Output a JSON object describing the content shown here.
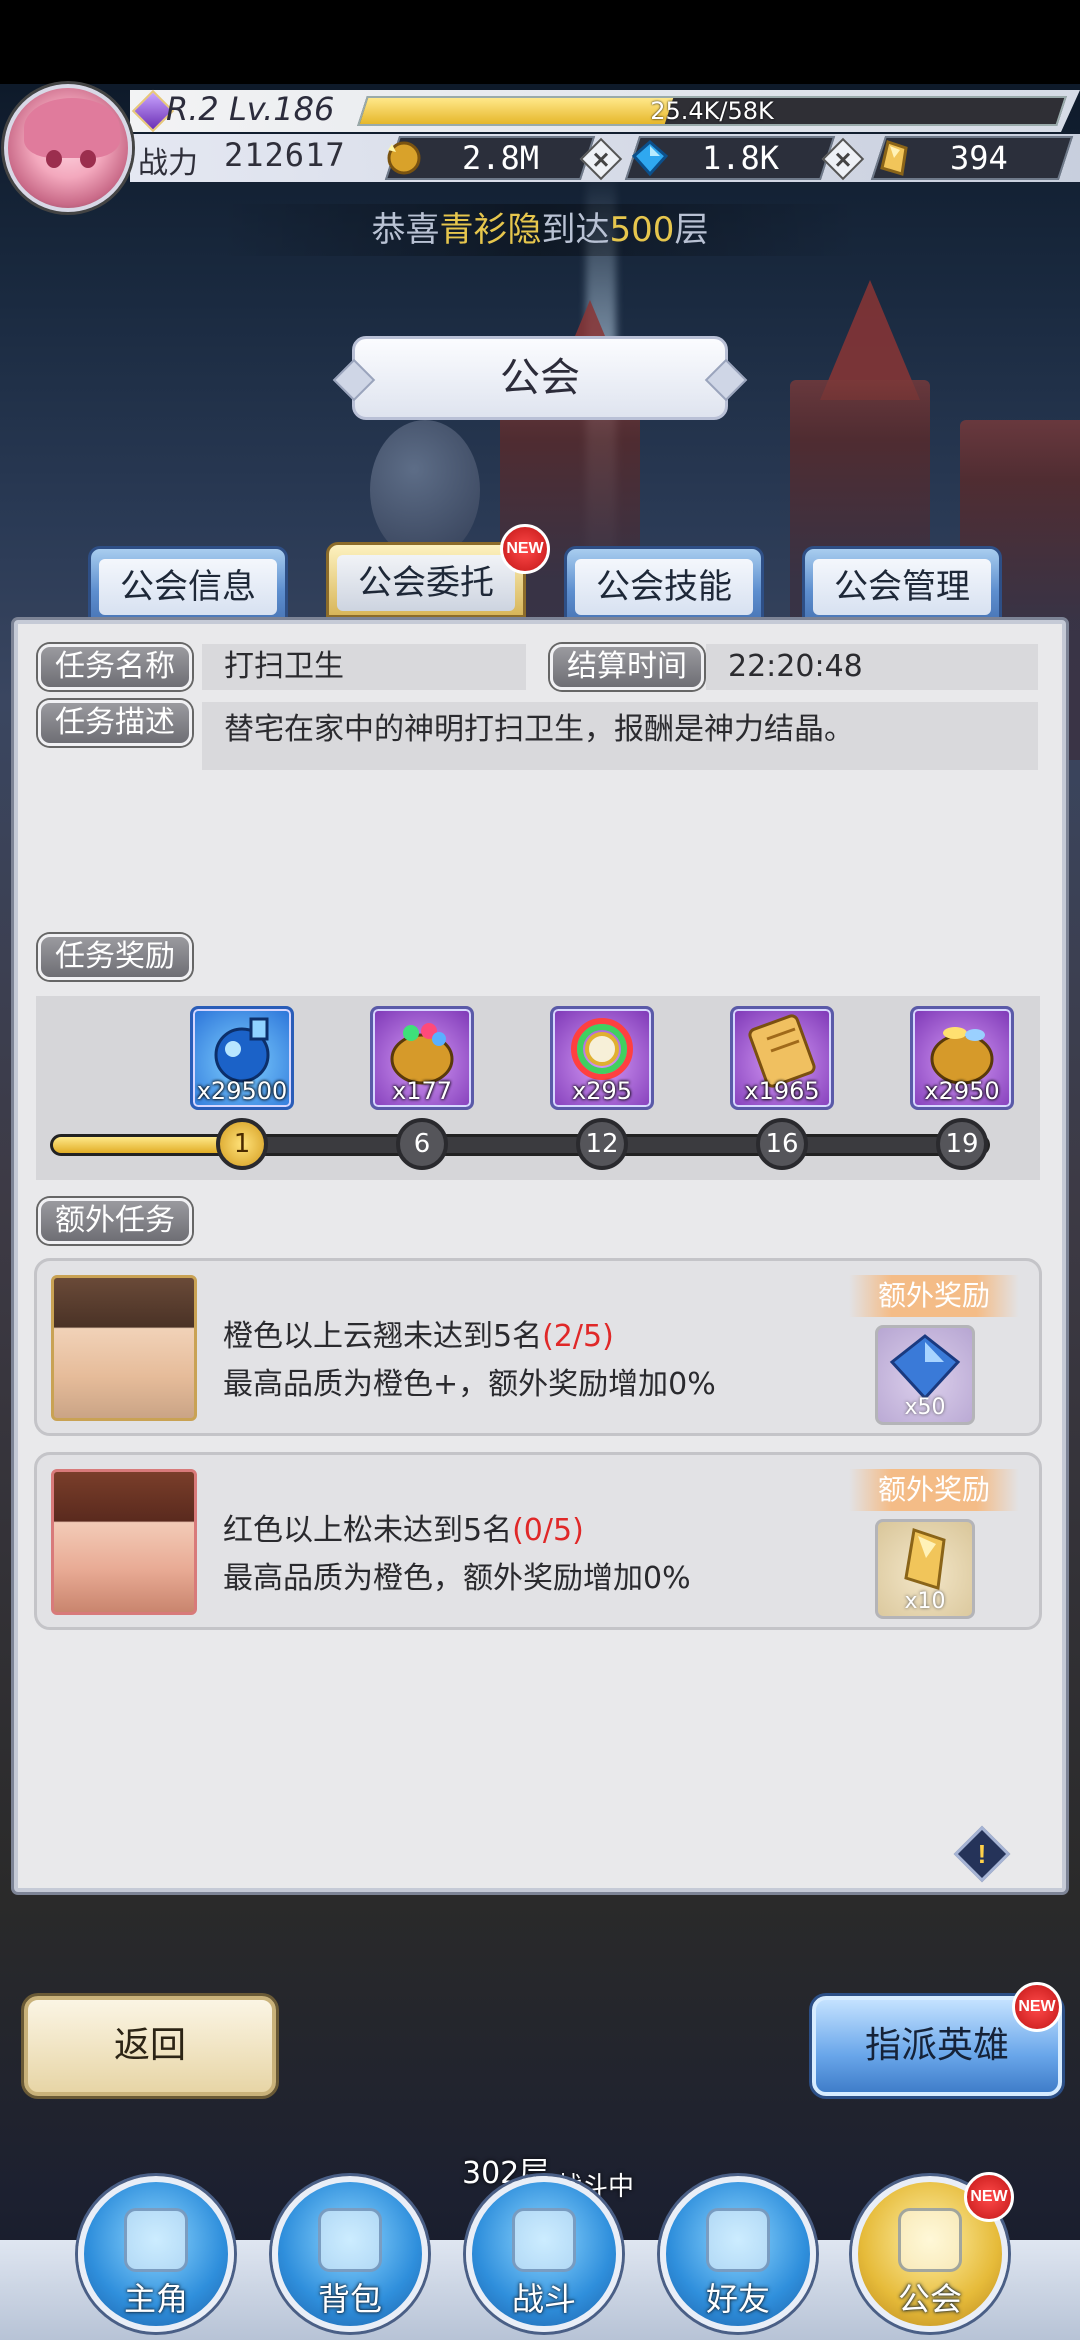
{
  "player": {
    "rank_level": "R.2 Lv.186",
    "exp_text": "25.4K/58K",
    "exp_progress": 0.438,
    "power_label": "战力",
    "power_value": "212617"
  },
  "resources": [
    {
      "name": "gold",
      "icon": "gold-coin-icon",
      "value": "2.8M"
    },
    {
      "name": "diamond",
      "icon": "blue-diamond-icon",
      "value": "1.8K"
    },
    {
      "name": "crystal",
      "icon": "gold-crystal-icon",
      "value": "394"
    }
  ],
  "announcement": {
    "prefix": "恭喜",
    "name": "青衫隐",
    "middle": "到达",
    "floor": "500",
    "suffix": "层"
  },
  "page_title": "公会",
  "tabs": [
    {
      "label": "公会信息",
      "active": false,
      "new": false
    },
    {
      "label": "公会委托",
      "active": true,
      "new": true
    },
    {
      "label": "公会技能",
      "active": false,
      "new": false
    },
    {
      "label": "公会管理",
      "active": false,
      "new": false
    }
  ],
  "badges": {
    "new": "NEW"
  },
  "task": {
    "name_label": "任务名称",
    "name_value": "打扫卫生",
    "time_label": "结算时间",
    "time_value": "22:20:48",
    "desc_label": "任务描述",
    "desc_value": "替宅在家中的神明打扫卫生，报酬是神力结晶。",
    "rewards_label": "任务奖励"
  },
  "rewards": [
    {
      "icon": "blue-potion-icon",
      "qty": "x29500",
      "color": "#3a8ee6"
    },
    {
      "icon": "gem-bag-icon",
      "qty": "x177",
      "color": "#a04ad0"
    },
    {
      "icon": "rainbow-medal-icon",
      "qty": "x295",
      "color": "#a04ad0"
    },
    {
      "icon": "scroll-icon",
      "qty": "x1965",
      "color": "#a04ad0"
    },
    {
      "icon": "gold-bag-icon",
      "qty": "x2950",
      "color": "#a04ad0"
    }
  ],
  "milestones": [
    "1",
    "6",
    "12",
    "16",
    "19"
  ],
  "milestone_progress": 0.19,
  "extra": {
    "section_label": "额外任务",
    "cards": [
      {
        "condition": "橙色以上云翘未达到5名",
        "progress": "(2/5)",
        "detail": "最高品质为橙色+，额外奖励增加0%",
        "bonus_label": "额外奖励",
        "bonus_icon": "blue-diamond-icon",
        "bonus_qty": "x50"
      },
      {
        "condition": "红色以上松未达到5名",
        "progress": "(0/5)",
        "detail": "最高品质为橙色，额外奖励增加0%",
        "bonus_label": "额外奖励",
        "bonus_icon": "gold-crystal-icon",
        "bonus_qty": "x10"
      }
    ]
  },
  "buttons": {
    "back": "返回",
    "assign": "指派英雄",
    "info": "!"
  },
  "status": {
    "floor": "302层",
    "battle": "战斗中"
  },
  "nav": [
    {
      "label": "主角",
      "icon": "hero-helmet-icon",
      "active": false
    },
    {
      "label": "背包",
      "icon": "backpack-icon",
      "active": false
    },
    {
      "label": "战斗",
      "icon": "crossed-swords-icon",
      "active": false
    },
    {
      "label": "好友",
      "icon": "handshake-icon",
      "active": false
    },
    {
      "label": "公会",
      "icon": "guild-crest-icon",
      "active": true
    }
  ]
}
